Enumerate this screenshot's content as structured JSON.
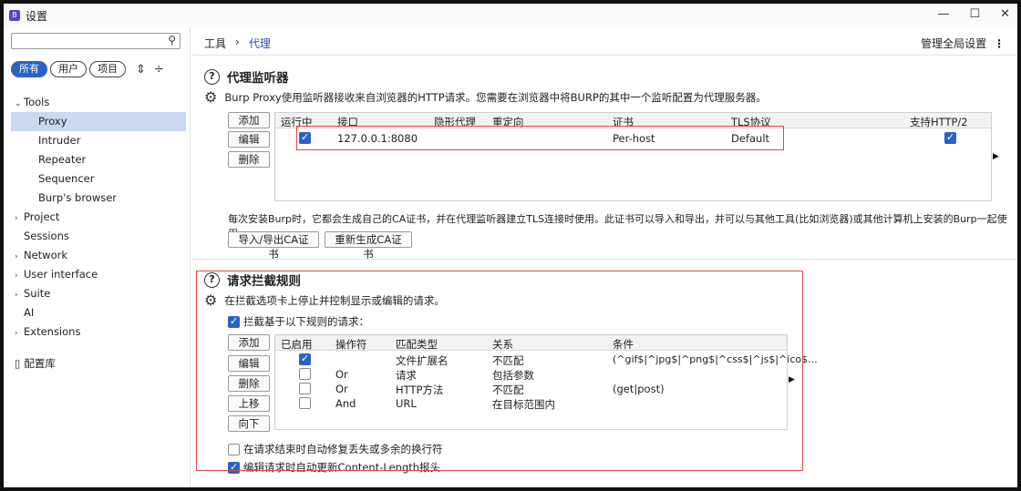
{
  "window": {
    "title": "设置",
    "controls": [
      "—",
      "☐",
      "✕"
    ]
  },
  "sidebar": {
    "search": {
      "placeholder": "",
      "value": ""
    },
    "filters": [
      "所有",
      "用户",
      "项目"
    ],
    "tree": [
      {
        "label": "Tools",
        "type": "group",
        "expanded": true
      },
      {
        "label": "Proxy",
        "type": "sub",
        "selected": true
      },
      {
        "label": "Intruder",
        "type": "sub"
      },
      {
        "label": "Repeater",
        "type": "sub"
      },
      {
        "label": "Sequencer",
        "type": "sub"
      },
      {
        "label": "Burp's browser",
        "type": "sub"
      },
      {
        "label": "Project",
        "type": "group"
      },
      {
        "label": "Sessions",
        "type": "leaf"
      },
      {
        "label": "Network",
        "type": "group"
      },
      {
        "label": "User interface",
        "type": "group"
      },
      {
        "label": "Suite",
        "type": "group"
      },
      {
        "label": "AI",
        "type": "leaf"
      },
      {
        "label": "Extensions",
        "type": "group"
      }
    ],
    "library": "配置库"
  },
  "header": {
    "breadcrumb": [
      "工具",
      "代理"
    ],
    "global_settings": "管理全局设置"
  },
  "listeners": {
    "title": "代理监听器",
    "description": "Burp Proxy使用监听器接收来自浏览器的HTTP请求。您需要在浏览器中将BURP的其中一个监听配置为代理服务器。",
    "buttons": [
      "添加",
      "编辑",
      "删除"
    ],
    "columns": [
      "运行中",
      "接口",
      "隐形代理",
      "重定向",
      "证书",
      "TLS协议",
      "支持HTTP/2"
    ],
    "rows": [
      {
        "running": true,
        "interface": "127.0.0.1:8080",
        "invisible": "",
        "redirect": "",
        "cert": "Per-host",
        "tls": "Default",
        "http2": true
      }
    ],
    "ca_text": "每次安装Burp时，它都会生成自己的CA证书，并在代理监听器建立TLS连接时使用。此证书可以导入和导出，并可以与其他工具(比如浏览器)或其他计算机上安装的Burp一起使用。",
    "ca_buttons": [
      "导入/导出CA证书",
      "重新生成CA证书"
    ]
  },
  "intercept": {
    "title": "请求拦截规则",
    "description": "在拦截选项卡上停止并控制显示或编辑的请求。",
    "enable_label": "拦截基于以下规则的请求：",
    "enable_checked": true,
    "buttons": [
      "添加",
      "编辑",
      "删除",
      "上移",
      "向下"
    ],
    "columns": [
      "已启用",
      "操作符",
      "匹配类型",
      "关系",
      "条件"
    ],
    "rows": [
      {
        "enabled": true,
        "op": "",
        "match": "文件扩展名",
        "rel": "不匹配",
        "cond": "(^gif$|^jpg$|^png$|^css$|^js$|^ico$..."
      },
      {
        "enabled": false,
        "op": "Or",
        "match": "请求",
        "rel": "包括参数",
        "cond": ""
      },
      {
        "enabled": false,
        "op": "Or",
        "match": "HTTP方法",
        "rel": "不匹配",
        "cond": "(get|post)"
      },
      {
        "enabled": false,
        "op": "And",
        "match": "URL",
        "rel": "在目标范围内",
        "cond": ""
      }
    ],
    "fix_newlines": {
      "label": "在请求结束时自动修复丢失或多余的换行符",
      "checked": false
    },
    "update_length": {
      "label": "编辑请求时自动更新Content-Length报头",
      "checked": true
    }
  }
}
